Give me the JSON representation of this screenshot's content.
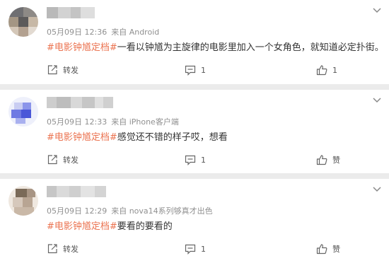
{
  "comments": [
    {
      "time": "05月09日 12:36",
      "source": "来自 Android",
      "hashtag": "#电影钟馗定档#",
      "text": "一看以钟馗为主旋律的电影里加入一个女角色，就知道必定扑街。",
      "repost_label": "转发",
      "comment_count": "1",
      "like_count": "1",
      "avatar_icon": "pixelated-avatar-icon",
      "avatar_colors": [
        "#6e6e74",
        "#8a8076",
        "#b9a895",
        "#d8ccc0"
      ]
    },
    {
      "time": "05月09日 12:33",
      "source": "来自 iPhone客户端",
      "hashtag": "#电影钟馗定档#",
      "text": "感觉还不错的样子哎，想看",
      "repost_label": "转发",
      "comment_count": "1",
      "like_count": "赞",
      "avatar_icon": "pixelated-avatar-icon",
      "avatar_colors": [
        "#4a57d8",
        "#8b95ea",
        "#c9cdf2",
        "#eef0fb"
      ]
    },
    {
      "time": "05月09日 12:29",
      "source": "来自 nova14系列够真才出色",
      "hashtag": "#电影钟馗定档#",
      "text": "要看的要看的",
      "repost_label": "转发",
      "comment_count": "1",
      "like_count": "赞",
      "avatar_icon": "pixelated-avatar-icon",
      "avatar_colors": [
        "#7a6a58",
        "#a89584",
        "#d6c8bb",
        "#efe8e0"
      ]
    }
  ],
  "icons": {
    "more": "chevron-down-icon",
    "repost": "repost-icon",
    "comment": "comment-icon",
    "like": "thumbs-up-icon"
  },
  "colors": {
    "hashtag": "#eb7350",
    "meta": "#909090",
    "body_text": "#333333",
    "action_text": "#555555",
    "background": "#ebebeb"
  }
}
